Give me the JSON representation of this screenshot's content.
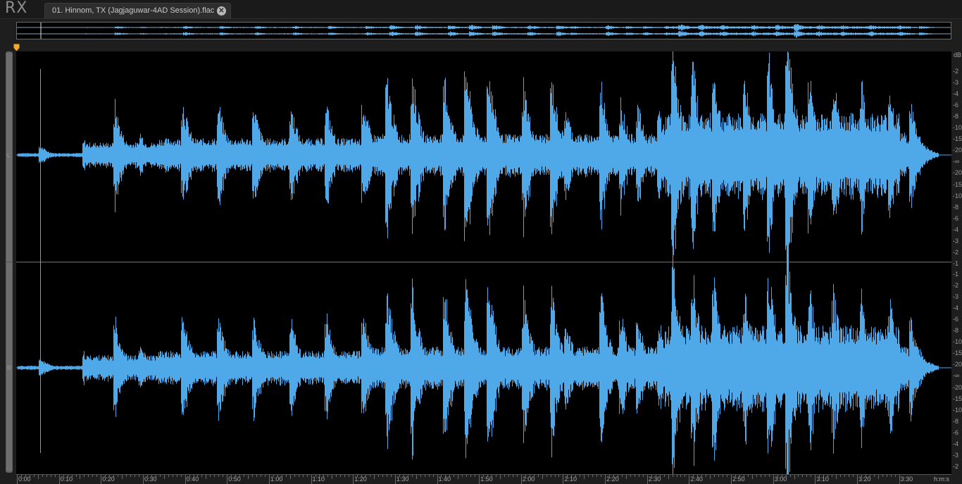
{
  "app": {
    "logo": "RX"
  },
  "tab": {
    "filename": "01. Hinnom, TX (Jagjaguwar-4AD Session).flac",
    "close_icon": "close-circle-icon"
  },
  "channels": [
    {
      "label": "L"
    },
    {
      "label": "R"
    }
  ],
  "db_ruler": {
    "unit": "dB",
    "top_ticks": [
      "-2",
      "-3",
      "-4",
      "-6",
      "-8",
      "-10",
      "-15",
      "-20",
      "-∞",
      "-20",
      "-15",
      "-10",
      "-8",
      "-6",
      "-4",
      "-3",
      "-2",
      "-1"
    ],
    "bottom_ticks": [
      "-1",
      "-2",
      "-3",
      "-4",
      "-6",
      "-8",
      "-10",
      "-15",
      "-20",
      "-∞",
      "-20",
      "-15",
      "-10",
      "-8",
      "-6",
      "-4",
      "-3",
      "-2"
    ]
  },
  "time_ruler": {
    "ticks": [
      "0:00",
      "0:10",
      "0:20",
      "0:30",
      "0:40",
      "0:50",
      "1:00",
      "1:10",
      "1:20",
      "1:30",
      "1:40",
      "1:50",
      "2:00",
      "2:10",
      "2:20",
      "2:30",
      "2:40",
      "2:50",
      "3:00",
      "3:10",
      "3:20",
      "3:30"
    ],
    "unit": "h:m:s"
  },
  "colors": {
    "waveform": "#4fa8e8",
    "background": "#000000",
    "playhead": "#f0a830"
  }
}
